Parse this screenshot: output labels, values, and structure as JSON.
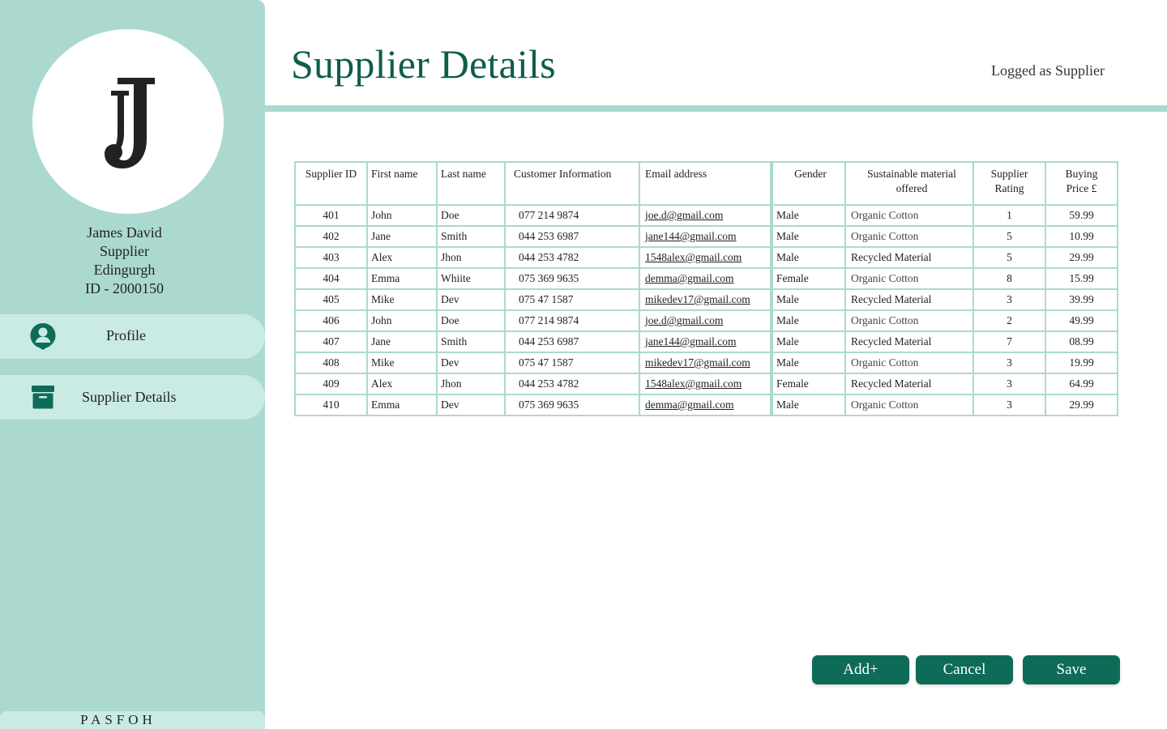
{
  "app": {
    "title": "Supplier Details",
    "logged_as": "Logged as Supplier",
    "brand": "PASFOH"
  },
  "user": {
    "name": "James David",
    "role": "Supplier",
    "city": "Edingurgh",
    "id": "ID - 2000150"
  },
  "sidebar": {
    "items": [
      {
        "label": "Profile",
        "icon": "user-icon"
      },
      {
        "label": "Supplier Details",
        "icon": "archive-box-icon"
      }
    ]
  },
  "table": {
    "headers": {
      "id": "Supplier ID",
      "first": "First name",
      "last": "Last name",
      "phone": "Customer Information",
      "email": "Email address",
      "gender": "Gender",
      "material_line1": "Sustainable material",
      "material_line2": "offered",
      "rating_line1": "Supplier",
      "rating_line2": "Rating",
      "price_line1": "Buying",
      "price_line2": "Price £"
    },
    "rows": [
      {
        "id": "401",
        "first": "John",
        "last": "Doe",
        "phone": "077 214 9874",
        "email": "joe.d@gmail.com",
        "gender": "Male",
        "material": "Organic Cotton",
        "rating": "1",
        "price": "59.99"
      },
      {
        "id": "402",
        "first": "Jane",
        "last": "Smith",
        "phone": "044 253 6987",
        "email": "jane144@gmail.com",
        "gender": "Male",
        "material": "Organic Cotton",
        "rating": "5",
        "price": "10.99"
      },
      {
        "id": "403",
        "first": "Alex",
        "last": "Jhon",
        "phone": "044 253 4782",
        "email": "1548alex@gmail.com",
        "gender": "Male",
        "material": "Recycled Material",
        "rating": "5",
        "price": "29.99"
      },
      {
        "id": "404",
        "first": "Emma",
        "last": "Whiite",
        "phone": "075 369 9635",
        "email": "demma@gmail.com",
        "gender": "Female",
        "material": "Organic Cotton",
        "rating": "8",
        "price": "15.99"
      },
      {
        "id": "405",
        "first": "Mike",
        "last": "Dev",
        "phone": "075 47 1587",
        "email": "mikedev17@gmail.com",
        "gender": "Male",
        "material": "Recycled Material",
        "rating": "3",
        "price": "39.99"
      },
      {
        "id": "406",
        "first": "John",
        "last": "Doe",
        "phone": "077 214 9874",
        "email": "joe.d@gmail.com",
        "gender": "Male",
        "material": "Organic Cotton",
        "rating": "2",
        "price": "49.99"
      },
      {
        "id": "407",
        "first": "Jane",
        "last": "Smith",
        "phone": "044 253 6987",
        "email": "jane144@gmail.com",
        "gender": "Male",
        "material": "Recycled Material",
        "rating": "7",
        "price": "08.99"
      },
      {
        "id": "408",
        "first": "Mike",
        "last": "Dev",
        "phone": "075 47 1587",
        "email": "mikedev17@gmail.com",
        "gender": "Male",
        "material": "Organic Cotton",
        "rating": "3",
        "price": "19.99"
      },
      {
        "id": "409",
        "first": "Alex",
        "last": "Jhon",
        "phone": "044 253 4782",
        "email": "1548alex@gmail.com",
        "gender": "Female",
        "material": "Recycled Material",
        "rating": "3",
        "price": "64.99"
      },
      {
        "id": "410",
        "first": "Emma",
        "last": "Dev",
        "phone": "075 369 9635",
        "email": "demma@gmail.com",
        "gender": "Male",
        "material": "Organic Cotton",
        "rating": "3",
        "price": "29.99"
      }
    ]
  },
  "buttons": {
    "add": "Add+",
    "cancel": "Cancel",
    "save": "Save"
  },
  "colors": {
    "accent": "#0e6b57",
    "title": "#0d5e4b",
    "sidebar": "#abd9d0",
    "nav_item": "#c9ebe4"
  }
}
